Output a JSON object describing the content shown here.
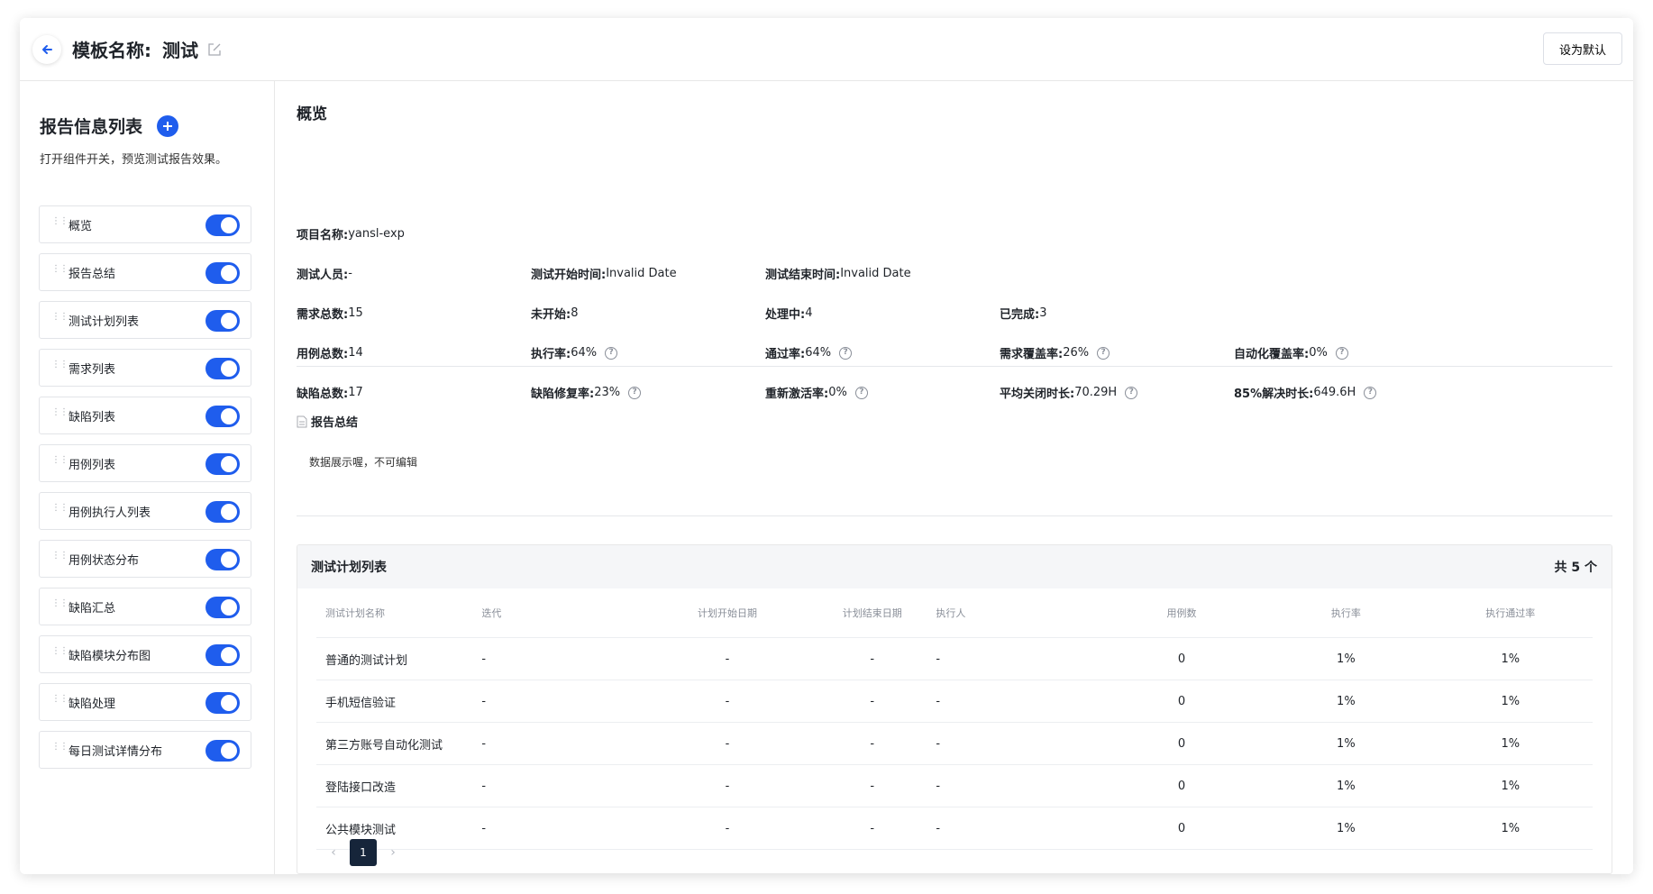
{
  "header": {
    "back_icon": "arrow-left-icon",
    "title_label": "模板名称:",
    "title_value": "测试",
    "edit_icon": "edit-icon",
    "default_button": "设为默认"
  },
  "sidebar": {
    "title": "报告信息列表",
    "add_icon": "plus-circle-icon",
    "subtitle": "打开组件开关，预览测试报告效果。",
    "items": [
      {
        "label": "概览",
        "enabled": true
      },
      {
        "label": "报告总结",
        "enabled": true
      },
      {
        "label": "测试计划列表",
        "enabled": true
      },
      {
        "label": "需求列表",
        "enabled": true
      },
      {
        "label": "缺陷列表",
        "enabled": true
      },
      {
        "label": "用例列表",
        "enabled": true
      },
      {
        "label": "用例执行人列表",
        "enabled": true
      },
      {
        "label": "用例状态分布",
        "enabled": true
      },
      {
        "label": "缺陷汇总",
        "enabled": true
      },
      {
        "label": "缺陷模块分布图",
        "enabled": true
      },
      {
        "label": "缺陷处理",
        "enabled": true
      },
      {
        "label": "每日测试详情分布",
        "enabled": true
      }
    ]
  },
  "overview": {
    "title": "概览",
    "project": {
      "k": "项目名称:",
      "v": "yansl-exp"
    },
    "tester": {
      "k": "测试人员:",
      "v": "-"
    },
    "start_time": {
      "k": "测试开始时间:",
      "v": "Invalid Date"
    },
    "end_time": {
      "k": "测试结束时间:",
      "v": "Invalid Date"
    },
    "req_total": {
      "k": "需求总数:",
      "v": "15"
    },
    "not_started": {
      "k": "未开始:",
      "v": "8"
    },
    "in_progress": {
      "k": "处理中:",
      "v": "4"
    },
    "done": {
      "k": "已完成:",
      "v": "3"
    },
    "case_total": {
      "k": "用例总数:",
      "v": "14"
    },
    "exec_rate": {
      "k": "执行率:",
      "v": "64%"
    },
    "pass_rate": {
      "k": "通过率:",
      "v": "64%"
    },
    "req_coverage": {
      "k": "需求覆盖率:",
      "v": "26%"
    },
    "auto_coverage": {
      "k": "自动化覆盖率:",
      "v": "0%"
    },
    "bug_total": {
      "k": "缺陷总数:",
      "v": "17"
    },
    "bug_fix_rate": {
      "k": "缺陷修复率:",
      "v": "23%"
    },
    "reactivate_rate": {
      "k": "重新激活率:",
      "v": "0%"
    },
    "avg_close": {
      "k": "平均关闭时长:",
      "v": "70.29H"
    },
    "resolve_85": {
      "k": "85%解决时长:",
      "v": "649.6H"
    }
  },
  "summary": {
    "title": "报告总结",
    "doc_icon": "document-icon",
    "text": "数据展示喔，不可编辑"
  },
  "plans": {
    "title": "测试计划列表",
    "count": "共 5 个",
    "columns": [
      "测试计划名称",
      "迭代",
      "计划开始日期",
      "计划结束日期",
      "执行人",
      "用例数",
      "执行率",
      "执行通过率"
    ],
    "rows": [
      [
        "普通的测试计划",
        "-",
        "-",
        "-",
        "-",
        "0",
        "1%",
        "1%"
      ],
      [
        "手机短信验证",
        "-",
        "-",
        "-",
        "-",
        "0",
        "1%",
        "1%"
      ],
      [
        "第三方账号自动化测试",
        "-",
        "-",
        "-",
        "-",
        "0",
        "1%",
        "1%"
      ],
      [
        "登陆接口改造",
        "-",
        "-",
        "-",
        "-",
        "0",
        "1%",
        "1%"
      ],
      [
        "公共模块测试",
        "-",
        "-",
        "-",
        "-",
        "0",
        "1%",
        "1%"
      ]
    ],
    "pagination": {
      "prev_icon": "chevron-left-icon",
      "current": "1",
      "next_icon": "chevron-right-icon"
    }
  }
}
